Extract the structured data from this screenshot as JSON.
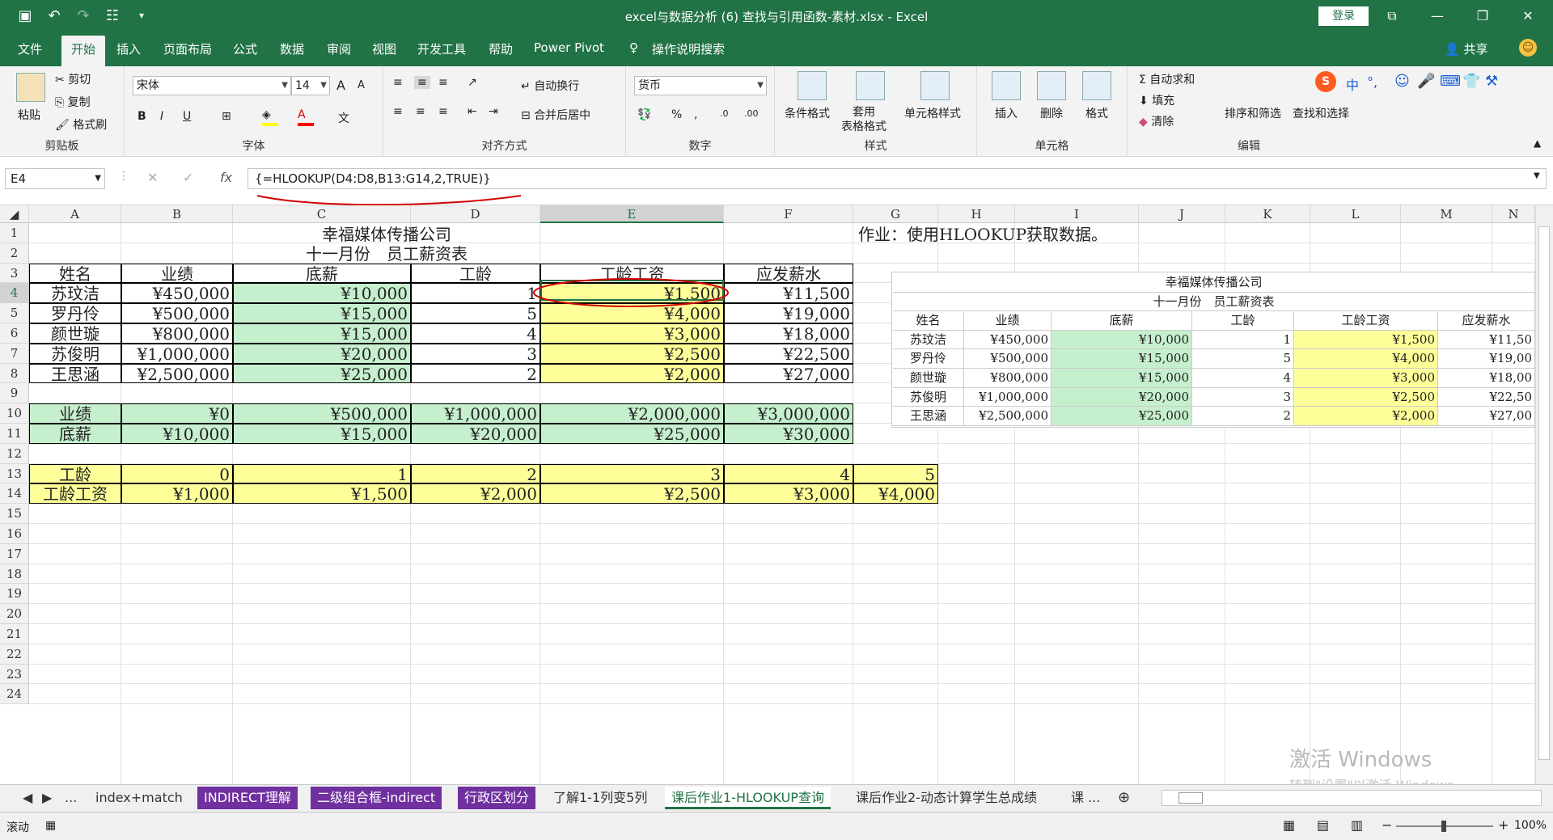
{
  "window": {
    "title": "excel与数据分析 (6) 查找与引用函数-素材.xlsx - Excel",
    "login": "登录"
  },
  "ribbon_tabs": [
    "文件",
    "开始",
    "插入",
    "页面布局",
    "公式",
    "数据",
    "审阅",
    "视图",
    "开发工具",
    "帮助",
    "Power Pivot",
    "操作说明搜索"
  ],
  "active_tab": "开始",
  "share": "共享",
  "ribbon": {
    "clipboard": {
      "paste": "粘贴",
      "cut": "剪切",
      "copy": "复制",
      "format_painter": "格式刷",
      "group": "剪贴板"
    },
    "font": {
      "name": "宋体",
      "size": "14",
      "bold": "B",
      "italic": "I",
      "underline": "U",
      "group": "字体",
      "grow": "A",
      "shrink": "A"
    },
    "align": {
      "wrap": "自动换行",
      "merge": "合并后居中",
      "group": "对齐方式"
    },
    "number": {
      "format": "货币",
      "group": "数字"
    },
    "styles": {
      "cond": "条件格式",
      "table": "套用\n表格格式",
      "cell": "单元格样式",
      "group": "样式"
    },
    "cells": {
      "insert": "插入",
      "delete": "删除",
      "format": "格式",
      "group": "单元格"
    },
    "editing": {
      "autosum": "自动求和",
      "fill": "填充",
      "clear": "清除",
      "sort": "排序和筛选",
      "find": "查找和选择",
      "group": "编辑"
    },
    "ime": [
      "中",
      "°,"
    ]
  },
  "formula_bar": {
    "name_box": "E4",
    "formula": "{=HLOOKUP(D4:D8,B13:G14,2,TRUE)}",
    "fx": "fx"
  },
  "columns": [
    "A",
    "B",
    "C",
    "D",
    "E",
    "F",
    "G",
    "H",
    "I",
    "J",
    "K",
    "L",
    "M",
    "N"
  ],
  "rows": [
    "1",
    "2",
    "3",
    "4",
    "5",
    "6",
    "7",
    "8",
    "9",
    "10",
    "11",
    "12",
    "13",
    "14",
    "15",
    "16",
    "17",
    "18",
    "19",
    "20",
    "21",
    "22",
    "23",
    "24"
  ],
  "sheet": {
    "title1": "幸福媒体传播公司",
    "title2": "十一月份　员工薪资表",
    "homework": "作业：使用HLOOKUP获取数据。",
    "headers": [
      "姓名",
      "业绩",
      "底薪",
      "工龄",
      "工龄工资",
      "应发薪水"
    ],
    "data": [
      [
        "苏玟洁",
        "¥450,000",
        "¥10,000",
        "1",
        "¥1,500",
        "¥11,500"
      ],
      [
        "罗丹伶",
        "¥500,000",
        "¥15,000",
        "5",
        "¥4,000",
        "¥19,000"
      ],
      [
        "颜世璇",
        "¥800,000",
        "¥15,000",
        "4",
        "¥3,000",
        "¥18,000"
      ],
      [
        "苏俊明",
        "¥1,000,000",
        "¥20,000",
        "3",
        "¥2,500",
        "¥22,500"
      ],
      [
        "王思涵",
        "¥2,500,000",
        "¥25,000",
        "2",
        "¥2,000",
        "¥27,000"
      ]
    ],
    "lookup1": {
      "row10": [
        "业绩",
        "¥0",
        "¥500,000",
        "¥1,000,000",
        "¥2,000,000",
        "¥3,000,000"
      ],
      "row11": [
        "底薪",
        "¥10,000",
        "¥15,000",
        "¥20,000",
        "¥25,000",
        "¥30,000"
      ]
    },
    "lookup2": {
      "row13": [
        "工龄",
        "0",
        "1",
        "2",
        "3",
        "4",
        "5"
      ],
      "row14": [
        "工龄工资",
        "¥1,000",
        "¥1,500",
        "¥2,000",
        "¥2,500",
        "¥3,000",
        "¥4,000"
      ]
    },
    "ref_table": {
      "title1": "幸福媒体传播公司",
      "title2": "十一月份　员工薪资表",
      "headers": [
        "姓名",
        "业绩",
        "底薪",
        "工龄",
        "工龄工资",
        "应发薪水"
      ],
      "data": [
        [
          "苏玟洁",
          "¥450,000",
          "¥10,000",
          "1",
          "¥1,500",
          "¥11,50"
        ],
        [
          "罗丹伶",
          "¥500,000",
          "¥15,000",
          "5",
          "¥4,000",
          "¥19,00"
        ],
        [
          "颜世璇",
          "¥800,000",
          "¥15,000",
          "4",
          "¥3,000",
          "¥18,00"
        ],
        [
          "苏俊明",
          "¥1,000,000",
          "¥20,000",
          "3",
          "¥2,500",
          "¥22,50"
        ],
        [
          "王思涵",
          "¥2,500,000",
          "¥25,000",
          "2",
          "¥2,000",
          "¥27,00"
        ]
      ]
    }
  },
  "sheet_tabs": [
    "...",
    "index+match",
    "INDIRECT理解",
    "二级组合框-indirect",
    "行政区划分",
    "了解1-1列变5列",
    "课后作业1-HLOOKUP查询",
    "课后作业2-动态计算学生总成绩",
    "课 ..."
  ],
  "active_sheet": "课后作业1-HLOOKUP查询",
  "status": {
    "mode": "滚动",
    "zoom": "100%"
  },
  "watermark": {
    "line1": "激活 Windows",
    "line2": "转到\"设置\"以激活 Windows。"
  }
}
